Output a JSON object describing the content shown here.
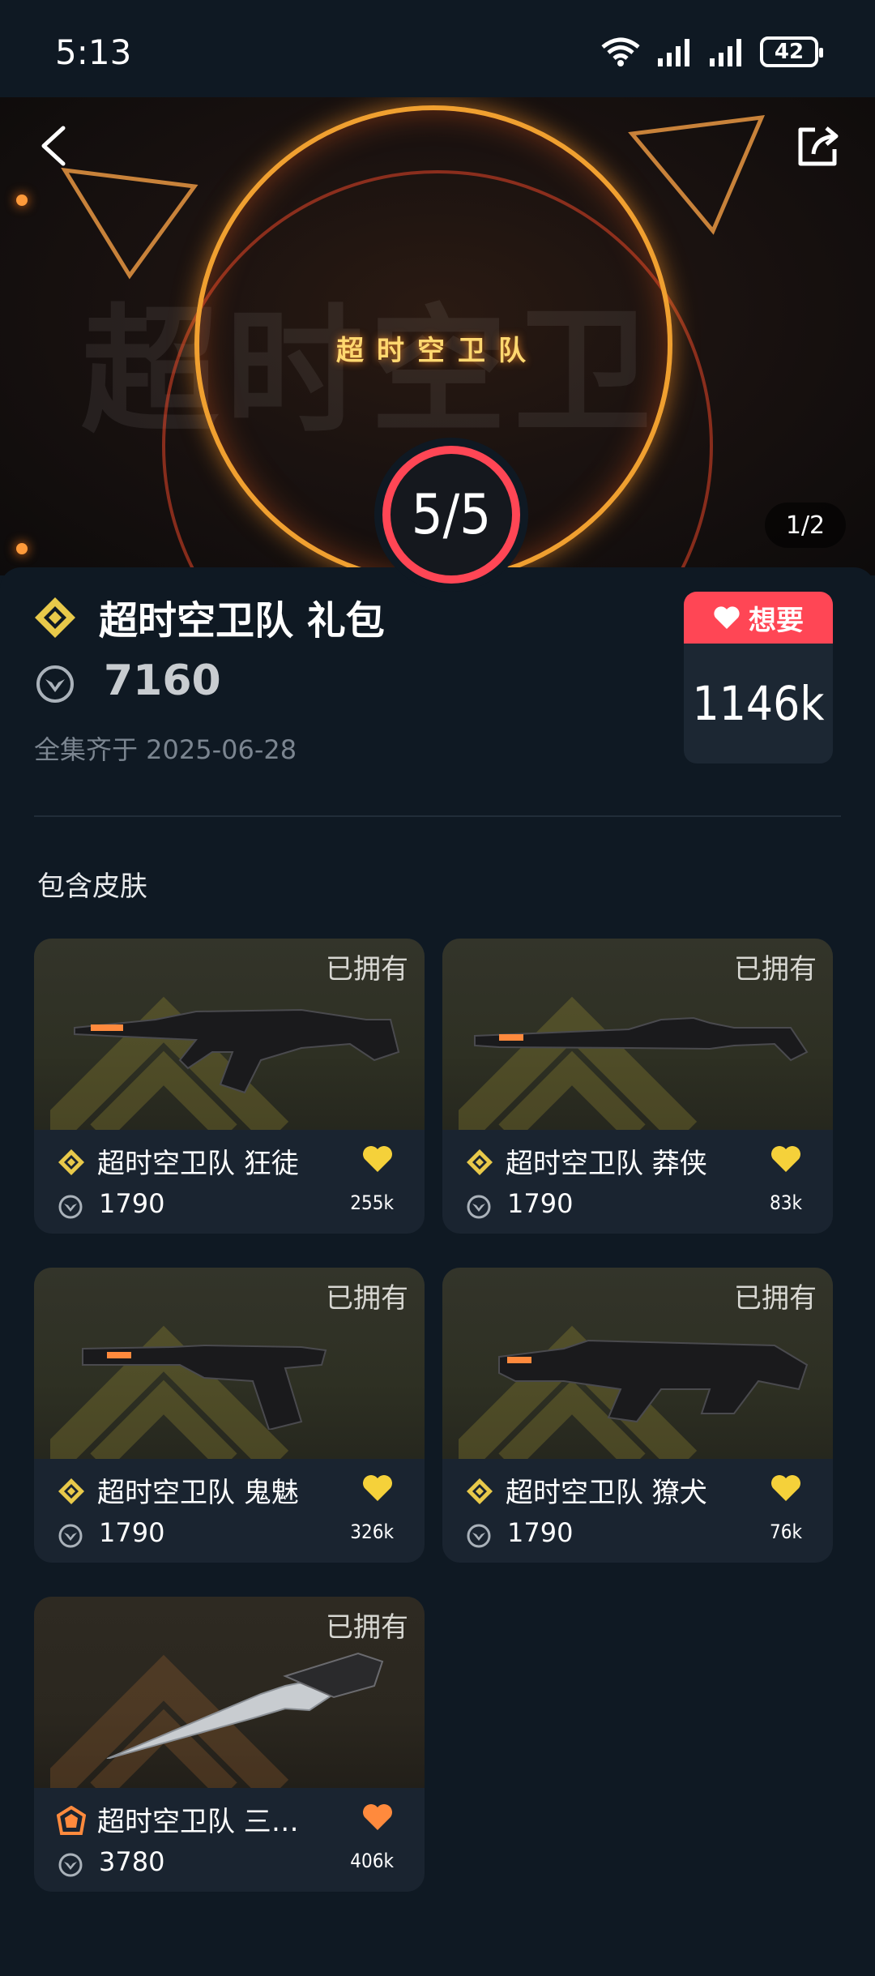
{
  "status_bar": {
    "time": "5:13",
    "battery": "42"
  },
  "banner": {
    "title": "超时空卫队",
    "bg_text": "超时空卫",
    "page_indicator": "1/2",
    "progress": "5/5"
  },
  "bundle": {
    "title": "超时空卫队 礼包",
    "price": "7160",
    "date": "全集齐于 2025-06-28",
    "want_label": "想要",
    "want_count": "1146k"
  },
  "section_title": "包含皮肤",
  "colors": {
    "accent": "#ff4655",
    "gold": "#e8c94a",
    "orange": "#ff8a3d",
    "bg": "#0f1923"
  },
  "skins": [
    {
      "owned": "已拥有",
      "name": "超时空卫队 狂徒",
      "price": "1790",
      "likes": "255k",
      "tier": "gold"
    },
    {
      "owned": "已拥有",
      "name": "超时空卫队 莽侠",
      "price": "1790",
      "likes": "83k",
      "tier": "gold"
    },
    {
      "owned": "已拥有",
      "name": "超时空卫队 鬼魅",
      "price": "1790",
      "likes": "326k",
      "tier": "gold"
    },
    {
      "owned": "已拥有",
      "name": "超时空卫队 獠犬",
      "price": "1790",
      "likes": "76k",
      "tier": "gold"
    },
    {
      "owned": "已拥有",
      "name": "超时空卫队 三…",
      "price": "3780",
      "likes": "406k",
      "tier": "orange"
    }
  ]
}
